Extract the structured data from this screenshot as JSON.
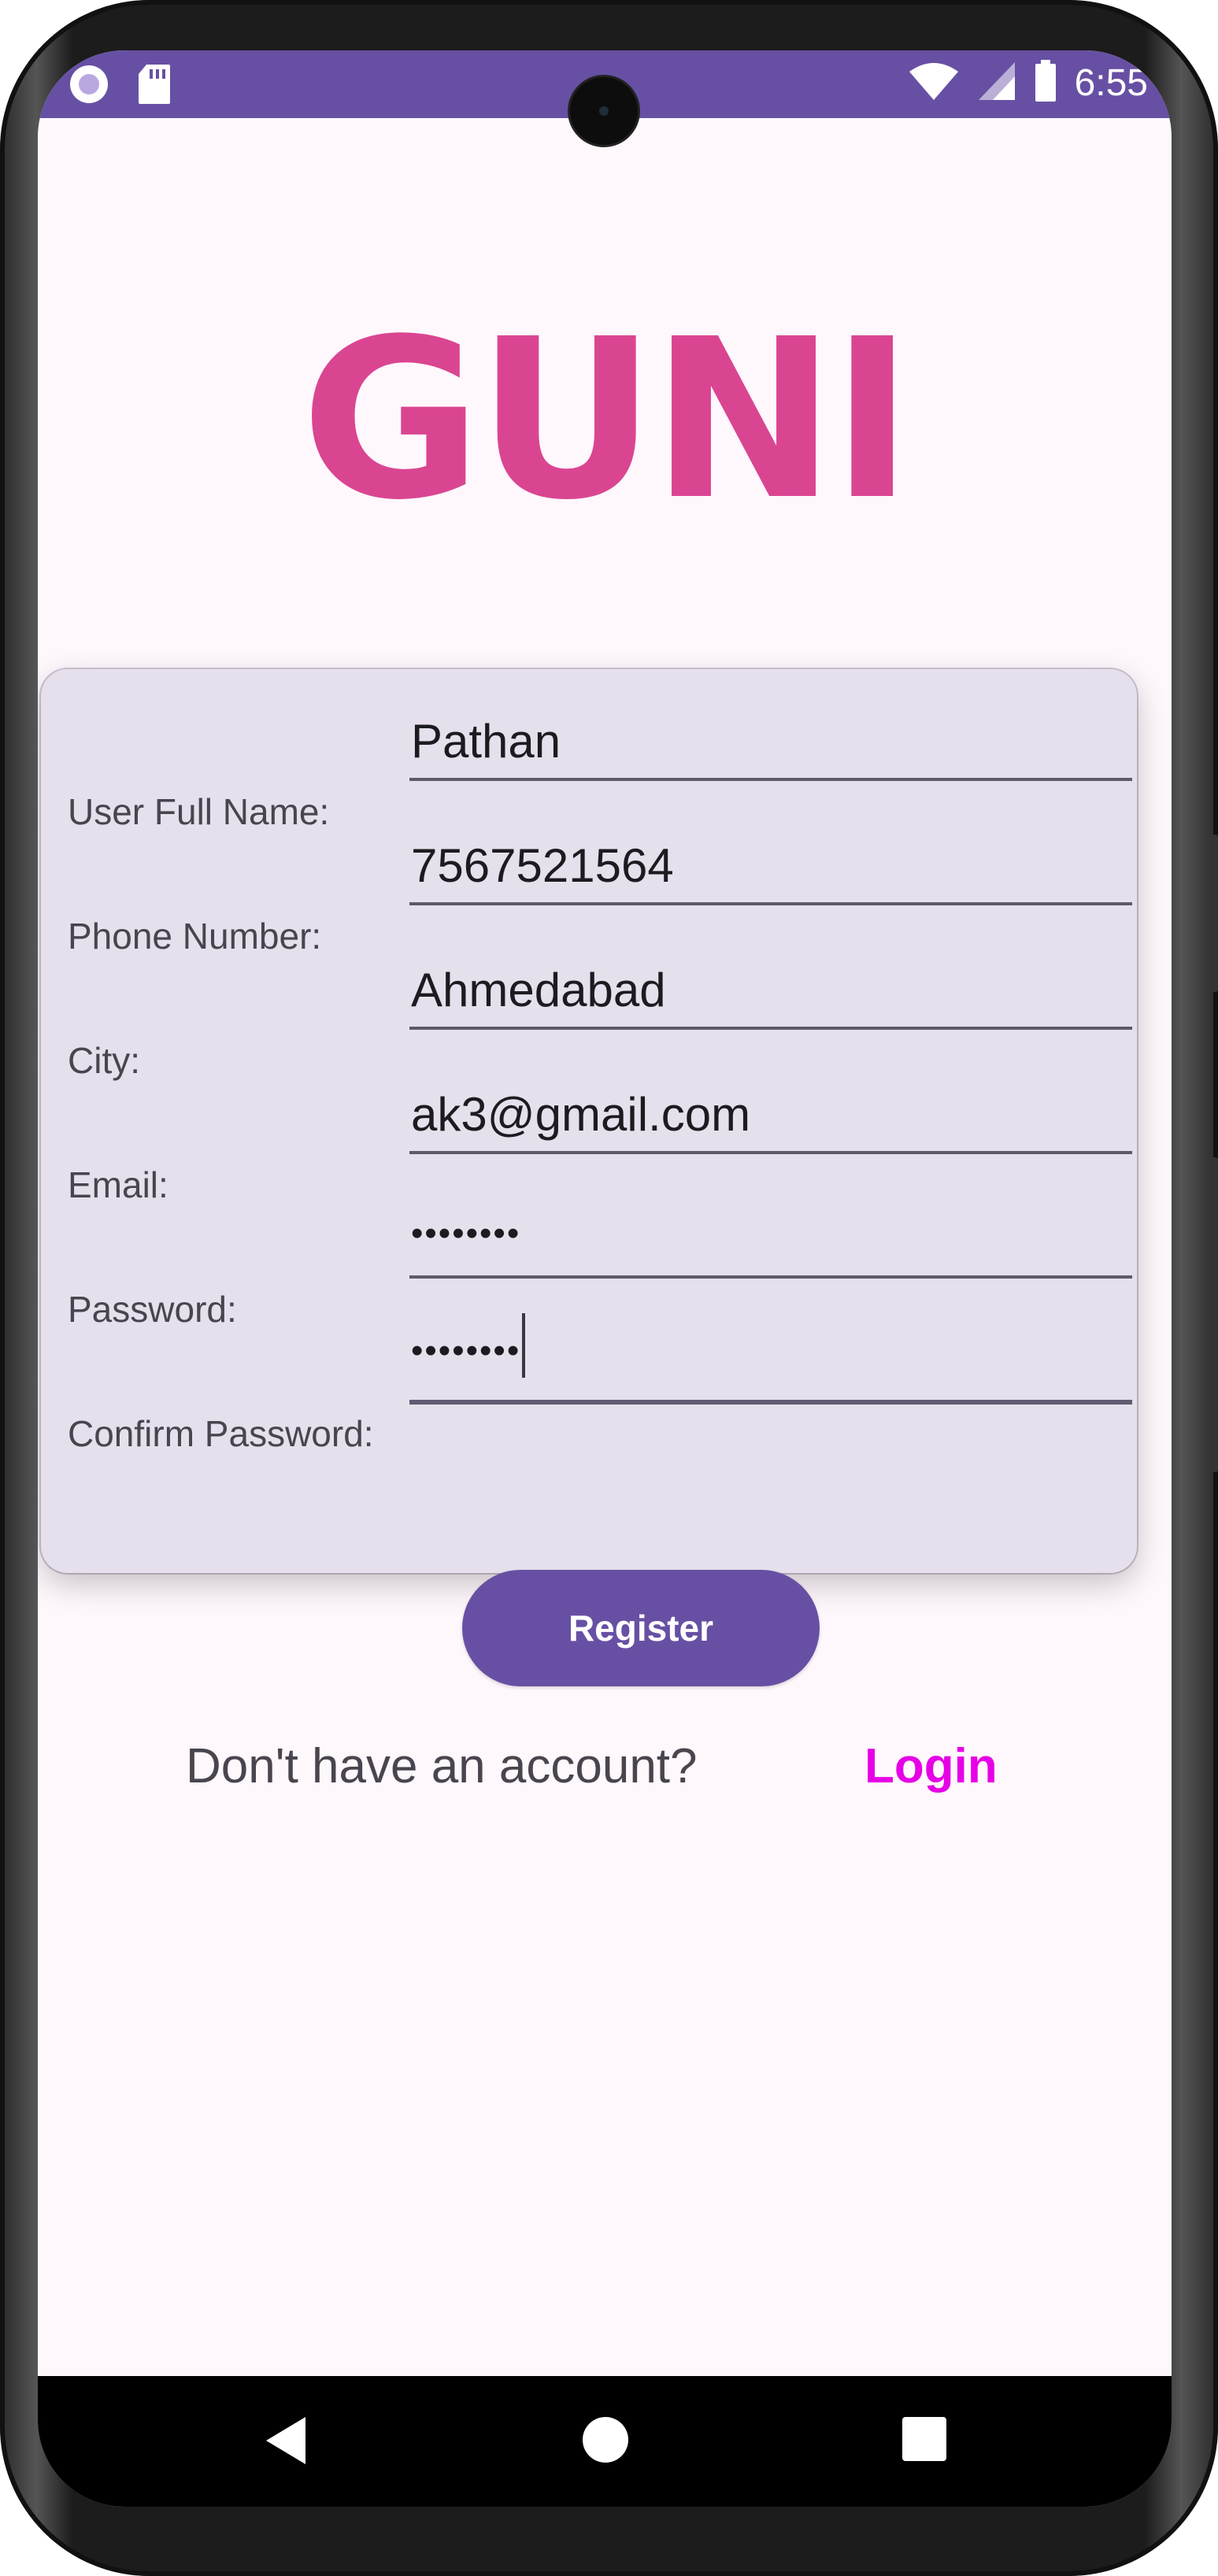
{
  "status_bar": {
    "time": "6:55",
    "left_icons": [
      "record-icon",
      "sd-card-icon"
    ],
    "right_icons": [
      "wifi-icon",
      "signal-icon",
      "battery-icon"
    ],
    "background_color": "#6750a4"
  },
  "logo": {
    "text": "GUNI",
    "color": "#da4592"
  },
  "form": {
    "fields": [
      {
        "label": "User Full Name:",
        "value": "Pathan"
      },
      {
        "label": "Phone Number:",
        "value": "7567521564"
      },
      {
        "label": "City:",
        "value": "Ahmedabad"
      },
      {
        "label": "Email:",
        "value": "ak3@gmail.com"
      },
      {
        "label": "Password:",
        "value": "••••••••"
      },
      {
        "label": "Confirm Password:",
        "value": "••••••••"
      }
    ],
    "register_label": "Register",
    "accent_color": "#6750a4"
  },
  "footer": {
    "prompt": "Don't have an account?",
    "login_label": "Login",
    "login_color": "#e600e6"
  },
  "nav_bar": {
    "icons": [
      "back-icon",
      "home-icon",
      "recents-icon"
    ]
  }
}
